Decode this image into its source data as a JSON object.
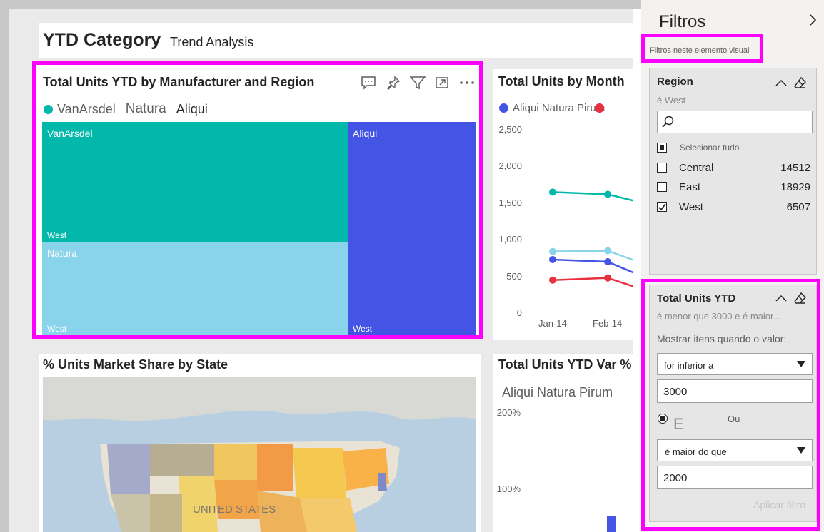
{
  "report": {
    "title": "YTD Category",
    "subtitle": "Trend Analysis"
  },
  "treemap": {
    "title": "Total Units YTD by Manufacturer and Region",
    "legend": [
      {
        "name": "VanArsdel",
        "color": "#01b8aa"
      },
      {
        "name": "Natura",
        "color": "#8ad4eb"
      },
      {
        "name": "Aliqui",
        "color": "#374649"
      }
    ],
    "cells": [
      {
        "label": "VanArsdel",
        "sub": "West",
        "color": "#01b8aa"
      },
      {
        "label": "Natura",
        "sub": "West",
        "color": "#8ad4eb"
      },
      {
        "label": "Aliqui",
        "sub": "West",
        "color": "#4455e6"
      }
    ]
  },
  "line_chart": {
    "title": "Total Units by Month",
    "legend": "Aliqui Natura Pirum",
    "chart_data": {
      "type": "line",
      "categories": [
        "Jan-14",
        "Feb-14"
      ],
      "y_ticks": [
        "2,500",
        "2,000",
        "1,500",
        "1,000",
        "500",
        "0"
      ],
      "ylim": [
        0,
        2500
      ],
      "series": [
        {
          "color": "#01b8aa",
          "values": [
            1650,
            1620
          ]
        },
        {
          "color": "#8ad4eb",
          "values": [
            840,
            850
          ]
        },
        {
          "color": "#4455e6",
          "values": [
            730,
            700
          ]
        },
        {
          "color": "#e8303e",
          "values": [
            450,
            480
          ]
        }
      ]
    }
  },
  "map": {
    "title": "% Units Market Share by State",
    "country_label": "UNITED STATES"
  },
  "var_chart": {
    "title": "Total Units YTD Var %",
    "legend": "Aliqui Natura Pirum",
    "y_ticks": [
      "200%",
      "100%"
    ]
  },
  "filters": {
    "pane_title": "Filtros",
    "visual_filters_label": "Filtros neste elemento visual",
    "region": {
      "title": "Region",
      "desc": "é West",
      "select_all": "Selecionar tudo",
      "items": [
        {
          "label": "Central",
          "count": "14512",
          "checked": false
        },
        {
          "label": "East",
          "count": "18929",
          "checked": false
        },
        {
          "label": "West",
          "count": "6507",
          "checked": true
        }
      ]
    },
    "units": {
      "title": "Total Units YTD",
      "desc": "é menor que 3000 e é maior...",
      "show_items_label": "Mostrar itens quando o valor:",
      "condition1": "for inferior a",
      "value1": "3000",
      "and_label": "E",
      "or_label": "Ou",
      "condition2": "é maior do que",
      "value2": "2000",
      "apply": "Aplicar filtro"
    }
  }
}
